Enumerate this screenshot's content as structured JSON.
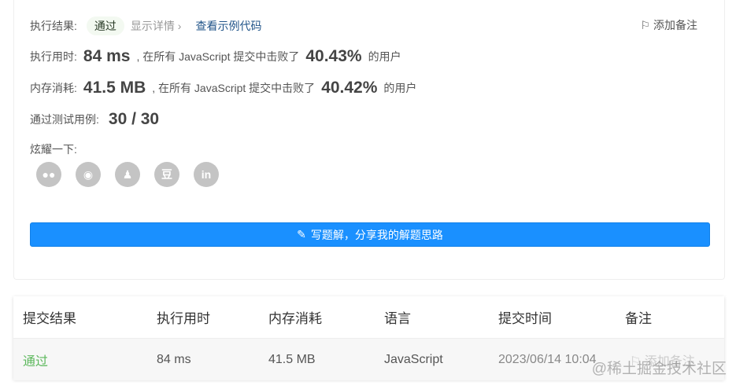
{
  "result": {
    "label": "执行结果:",
    "status": "通过",
    "detail": "显示详情 ›",
    "example_link": "查看示例代码",
    "add_note": "添加备注"
  },
  "runtime": {
    "label": "执行用时:",
    "value": "84 ms",
    "text": ", 在所有 JavaScript 提交中击败了",
    "percent": "40.43%",
    "suffix": "的用户"
  },
  "memory": {
    "label": "内存消耗:",
    "value": "41.5 MB",
    "text": ", 在所有 JavaScript 提交中击败了",
    "percent": "40.42%",
    "suffix": "的用户"
  },
  "tests": {
    "label": "通过测试用例:",
    "value": "30 / 30"
  },
  "share": {
    "label": "炫耀一下:",
    "icons": [
      "wechat",
      "weibo",
      "qq",
      "douban",
      "linkedin"
    ],
    "douban_glyph": "豆",
    "linkedin_glyph": "in"
  },
  "write_button": "写题解，分享我的解题思路",
  "table": {
    "headers": [
      "提交结果",
      "执行用时",
      "内存消耗",
      "语言",
      "提交时间",
      "备注"
    ],
    "row": {
      "status": "通过",
      "runtime": "84 ms",
      "memory": "41.5 MB",
      "language": "JavaScript",
      "time": "2023/06/14 10:04",
      "note": "添加备注"
    }
  },
  "watermark": "@稀土掘金技术社区"
}
